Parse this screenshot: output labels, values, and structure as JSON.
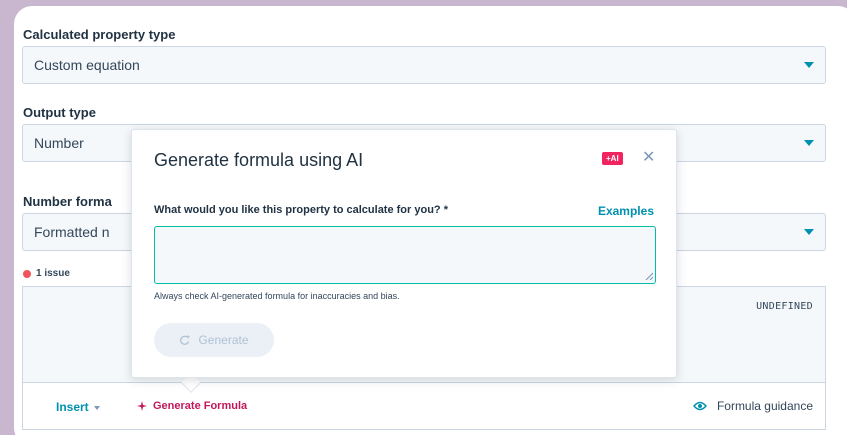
{
  "form": {
    "calc_type": {
      "label": "Calculated property type",
      "value": "Custom equation"
    },
    "output_type": {
      "label": "Output type",
      "value": "Number"
    },
    "number_format": {
      "label": "Number forma",
      "value": "Formatted n"
    },
    "issue_text": "1 issue",
    "editor": {
      "type_badge": "UNDEFINED"
    },
    "toolbar": {
      "insert_label": "Insert",
      "generate_formula_label": "Generate Formula",
      "guidance_label": "Formula guidance"
    }
  },
  "modal": {
    "title": "Generate formula using AI",
    "ai_badge": "+AI",
    "question_label": "What would you like this property to calculate for you? *",
    "examples_link": "Examples",
    "textarea_value": "",
    "hint": "Always check AI-generated formula for inaccuracies and bias.",
    "generate_button": "Generate"
  },
  "colors": {
    "accent": "#0091ae",
    "ai_pink": "#f2245f",
    "error_red": "#f2545b",
    "background": "#c9b6cf"
  }
}
